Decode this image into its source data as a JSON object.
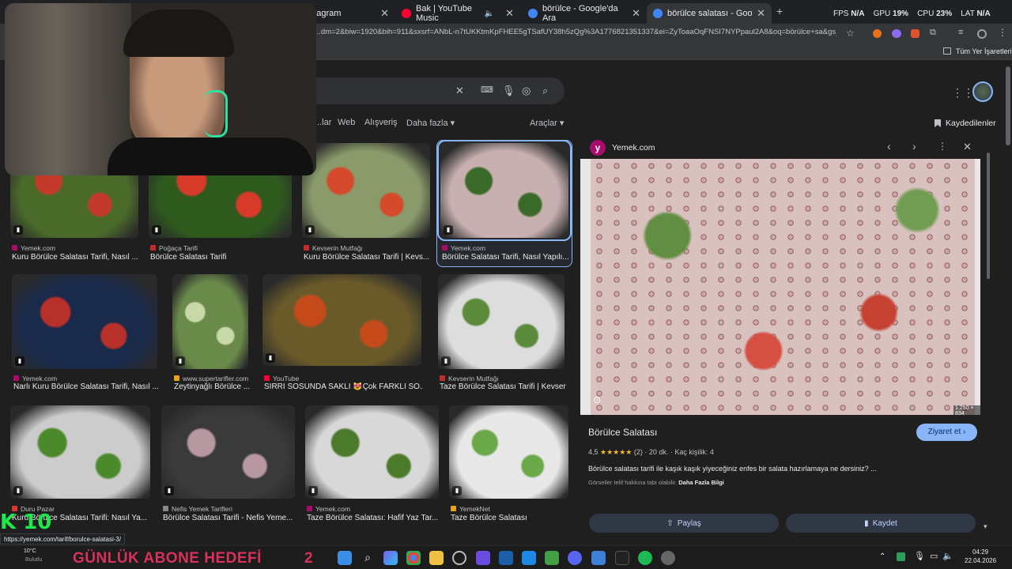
{
  "browser": {
    "tabs": [
      {
        "label": "...tagram",
        "color": "#e1306c"
      },
      {
        "label": "Bak | YouTube Music",
        "color": "#ff0033"
      },
      {
        "label": "börülce - Google'da Ara",
        "color": "#4285f4"
      },
      {
        "label": "börülce salatası - Google'da Ar...",
        "color": "#4285f4"
      }
    ],
    "new_tab": "+",
    "stats": {
      "fps_label": "FPS",
      "fps": "N/A",
      "gpu_label": "GPU",
      "gpu": "19%",
      "cpu_label": "CPU",
      "cpu": "23%",
      "lat_label": "LAT",
      "lat": "N/A"
    },
    "url": "...dm=2&biw=1920&bih=911&sxsrf=ANbL-n7tUKKtmKpFHEE5gTSafUY38h5zQg%3A1776821351337&ei=ZyToaaOqFNSI7NYPpaul2A8&oq=börülce+sa&gs_lp=...",
    "bookmarks_label": "Tüm Yer İşaretleri"
  },
  "search": {
    "query": ""
  },
  "nav_tabs": [
    "...lar",
    "Web",
    "Alışveriş",
    "Daha fazla ▾",
    "Araçlar ▾"
  ],
  "saved_label": "Kaydedilenler",
  "results": [
    {
      "source": "Yemek.com",
      "title": "Kuru Börülce Salatası Tarifi, Nasıl ...",
      "color": "#a90b6b"
    },
    {
      "source": "Poğaça Tarifi",
      "title": "Börülce Salatası Tarifi",
      "color": "#c52b2b"
    },
    {
      "source": "Kevserin Mutfağı",
      "title": "Kuru Börülce Salatası Tarifi | Kevs...",
      "color": "#c52b2b"
    },
    {
      "source": "Yemek.com",
      "title": "Börülce Salatası Tarifi, Nasıl Yapılı...",
      "color": "#a90b6b"
    },
    {
      "source": "Yemek.com",
      "title": "Narlı Kuru Börülce Salatası Tarifi, Nasıl ...",
      "color": "#a90b6b"
    },
    {
      "source": "www.supertarifler.com",
      "title": "Zeytinyağlı Börülce ...",
      "color": "#e8a21b"
    },
    {
      "source": "YouTube",
      "title": "SIRRI SOSUNDA SAKLI 😻Çok FARKLI SO...",
      "color": "#ff0033"
    },
    {
      "source": "Kevserin Mutfağı",
      "title": "Taze Börülce Salatası Tarifi | Kevser...",
      "color": "#c52b2b"
    },
    {
      "source": "Duru Pazar",
      "title": "Kuru Börülce Salatası Tarifi: Nasıl Ya...",
      "color": "#d33"
    },
    {
      "source": "Nefis Yemek Tarifleri",
      "title": "Börülce Salatası Tarifi - Nefis Yeme...",
      "color": "#888"
    },
    {
      "source": "Yemek.com",
      "title": "Taze Börülce Salatası: Hafif Yaz Tar...",
      "color": "#a90b6b"
    },
    {
      "source": "YemekNet",
      "title": "Taze Börülce Salatası",
      "color": "#e8a21b"
    }
  ],
  "panel": {
    "site": "Yemek.com",
    "size": "1.250 × 834",
    "title": "Börülce Salatası",
    "visit": "Ziyaret et",
    "rating": "4,5",
    "stars": "★★★★★",
    "reviews": "(2)",
    "time": "20 dk.",
    "servings": "Kaç kişilik: 4",
    "desc": "Börülce salatası tarifi ile kaşık kaşık yiyeceğiniz enfes bir salata hazırlamaya ne dersiniz? ...",
    "copyright": "Görseller telif hakkına tabi olabilir.",
    "more": "Daha Fazla Bilgi",
    "share": "Paylaş",
    "save": "Kaydet"
  },
  "status_url": "https://yemek.com/tarif/borulce-salatasi-3/",
  "overlay": {
    "k10": "K 10",
    "banner": "GÜNLÜK ABONE HEDEFİ",
    "count": "2",
    "temp": "10°C",
    "weather": "Bulutlu"
  },
  "clock": {
    "time": "04:29",
    "date": "22.04.2026"
  }
}
